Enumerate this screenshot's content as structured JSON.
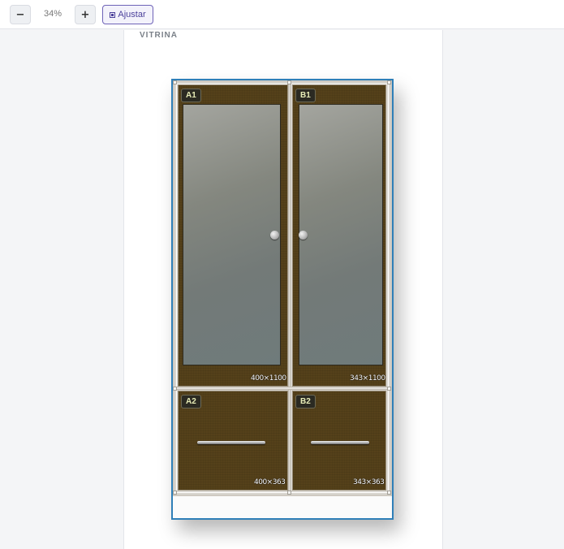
{
  "toolbar": {
    "zoom_out_label": "−",
    "zoom_level": "34%",
    "zoom_in_label": "+",
    "fit_label": "Ajustar",
    "fit_icon": "fit-to-screen-icon"
  },
  "canvas": {
    "title": "VITRINA",
    "selection_color": "#2f7fb8",
    "door_color": "#55411a",
    "label_color": "#e7ecb6",
    "doors": [
      {
        "id": "A1",
        "size": "400×1100",
        "type": "glass",
        "knob": "knob-right"
      },
      {
        "id": "B1",
        "size": "343×1100",
        "type": "glass",
        "knob": "knob-left"
      },
      {
        "id": "A2",
        "size": "400×363",
        "type": "drawer",
        "handle": "bar-handle"
      },
      {
        "id": "B2",
        "size": "343×363",
        "type": "drawer",
        "handle": "bar-handle"
      }
    ]
  }
}
